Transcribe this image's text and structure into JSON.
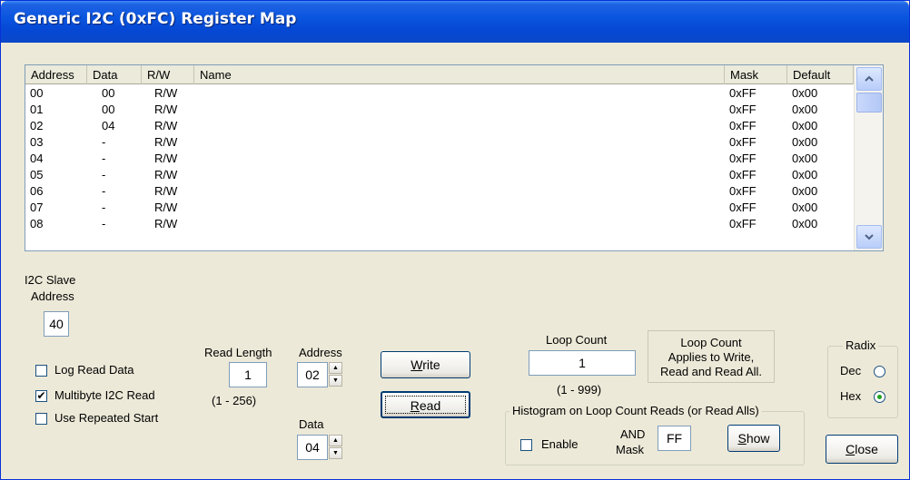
{
  "window": {
    "title": "Generic I2C (0xFC) Register Map"
  },
  "table": {
    "columns": [
      "Address",
      "Data",
      "R/W",
      "Name",
      "Mask",
      "Default"
    ],
    "rows": [
      {
        "address": "00",
        "data": "00",
        "rw": "R/W",
        "name": "",
        "mask": "0xFF",
        "default": "0x00"
      },
      {
        "address": "01",
        "data": "00",
        "rw": "R/W",
        "name": "",
        "mask": "0xFF",
        "default": "0x00"
      },
      {
        "address": "02",
        "data": "04",
        "rw": "R/W",
        "name": "",
        "mask": "0xFF",
        "default": "0x00"
      },
      {
        "address": "03",
        "data": "-",
        "rw": "R/W",
        "name": "",
        "mask": "0xFF",
        "default": "0x00"
      },
      {
        "address": "04",
        "data": "-",
        "rw": "R/W",
        "name": "",
        "mask": "0xFF",
        "default": "0x00"
      },
      {
        "address": "05",
        "data": "-",
        "rw": "R/W",
        "name": "",
        "mask": "0xFF",
        "default": "0x00"
      },
      {
        "address": "06",
        "data": "-",
        "rw": "R/W",
        "name": "",
        "mask": "0xFF",
        "default": "0x00"
      },
      {
        "address": "07",
        "data": "-",
        "rw": "R/W",
        "name": "",
        "mask": "0xFF",
        "default": "0x00"
      },
      {
        "address": "08",
        "data": "-",
        "rw": "R/W",
        "name": "",
        "mask": "0xFF",
        "default": "0x00"
      }
    ],
    "scroll_up_icon": "chevron-up-icon",
    "scroll_down_icon": "chevron-down-icon"
  },
  "slave": {
    "label_line1": "I2C Slave",
    "label_line2": "Address",
    "value": "40"
  },
  "options": {
    "log_read_data": {
      "label": "Log Read Data",
      "checked": false
    },
    "multibyte_read": {
      "label": "Multibyte I2C Read",
      "checked": true
    },
    "repeated_start": {
      "label": "Use Repeated Start",
      "checked": false
    }
  },
  "read_length": {
    "label": "Read Length",
    "value": "1",
    "range": "(1 - 256)"
  },
  "address": {
    "label": "Address",
    "value": "02"
  },
  "data_field": {
    "label": "Data",
    "value": "04"
  },
  "buttons": {
    "write_first": "W",
    "write_rest": "rite",
    "read_first": "R",
    "read_rest": "ead",
    "show_first": "S",
    "show_rest": "how",
    "close_first": "C",
    "close_rest": "lose"
  },
  "loop": {
    "label": "Loop Count",
    "value": "1",
    "range": "(1 - 999)",
    "info_line1": "Loop Count",
    "info_line2": "Applies to Write,",
    "info_line3": "Read and Read All."
  },
  "histogram": {
    "title": "Histogram on Loop Count Reads (or Read Alls)",
    "enable_label": "Enable",
    "enable_checked": false,
    "and_label": "AND",
    "mask_label": "Mask",
    "mask_value": "FF"
  },
  "radix": {
    "title": "Radix",
    "dec_label": "Dec",
    "hex_label": "Hex",
    "selected": "Hex"
  }
}
